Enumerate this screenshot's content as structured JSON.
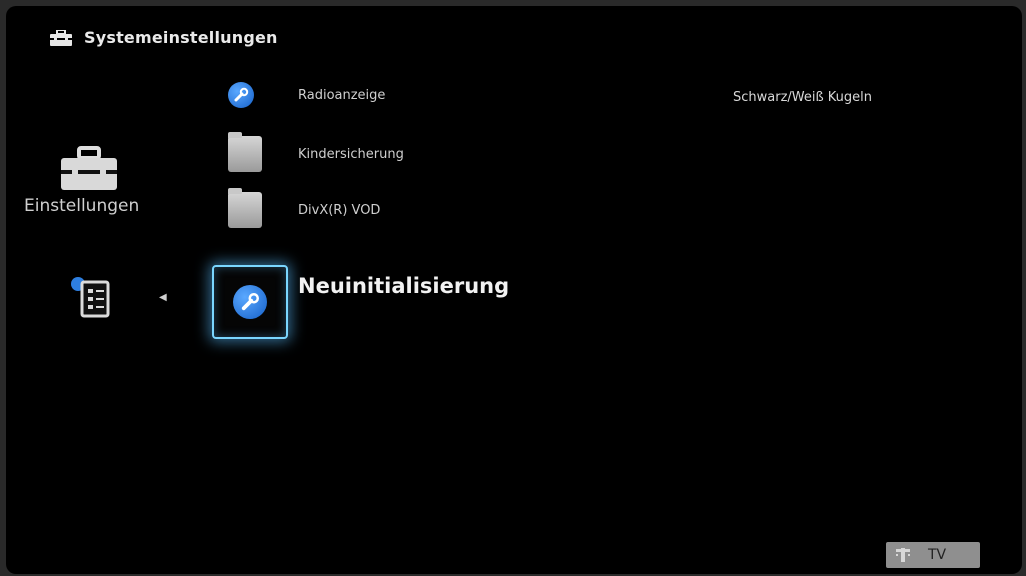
{
  "header": {
    "title": "Systemeinstellungen",
    "icon": "toolbox-icon"
  },
  "category": {
    "label": "Einstellungen",
    "icon": "toolbox-icon"
  },
  "previous_category": {
    "icon": "checklist-icon"
  },
  "menu": {
    "items": [
      {
        "label": "Radioanzeige",
        "icon": "wrench-icon"
      },
      {
        "label": "Kindersicherung",
        "icon": "folder-icon"
      },
      {
        "label": "DivX(R) VOD",
        "icon": "folder-icon"
      }
    ],
    "selected": {
      "label": "Neuinitialisierung",
      "icon": "wrench-icon"
    }
  },
  "info": {
    "text": "Schwarz/Weiß Kugeln"
  },
  "footer": {
    "tv_label": "TV",
    "icon": "telekom-t-icon"
  },
  "colors": {
    "background": "#000000",
    "highlight": "#7ad6ff",
    "accent": "#1f7ae0"
  }
}
